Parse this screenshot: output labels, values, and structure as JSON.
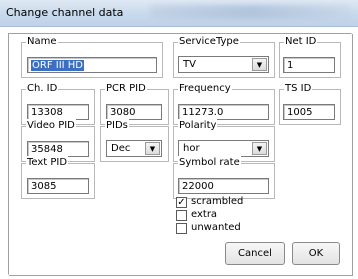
{
  "window": {
    "title": "Change channel data"
  },
  "name": {
    "label": "Name",
    "value": "ORF III HD"
  },
  "service_type": {
    "label": "ServiceType",
    "value": "TV"
  },
  "net_id": {
    "label": "Net ID",
    "value": "1"
  },
  "ch_id": {
    "label": "Ch. ID",
    "value": "13308"
  },
  "pcr_pid": {
    "label": "PCR PID",
    "value": "3080"
  },
  "frequency": {
    "label": "Frequency",
    "value": "11273.0"
  },
  "ts_id": {
    "label": "TS ID",
    "value": "1005"
  },
  "video_pid": {
    "label": "Video PID",
    "value": "35848"
  },
  "pids": {
    "label": "PIDs",
    "value": "Dec"
  },
  "polarity": {
    "label": "Polarity",
    "value": "hor"
  },
  "text_pid": {
    "label": "Text PID",
    "value": "3085"
  },
  "symbol_rate": {
    "label": "Symbol rate",
    "value": "22000"
  },
  "checkboxes": [
    {
      "label": "scrambled",
      "checked": true,
      "mark": "✓"
    },
    {
      "label": "extra",
      "checked": false,
      "mark": ""
    },
    {
      "label": "unwanted",
      "checked": false,
      "mark": ""
    }
  ],
  "buttons": {
    "cancel": "Cancel",
    "ok": "OK"
  },
  "icons": {
    "dropdown": "chevron-down-icon",
    "dropdown_glyph": "▼"
  }
}
